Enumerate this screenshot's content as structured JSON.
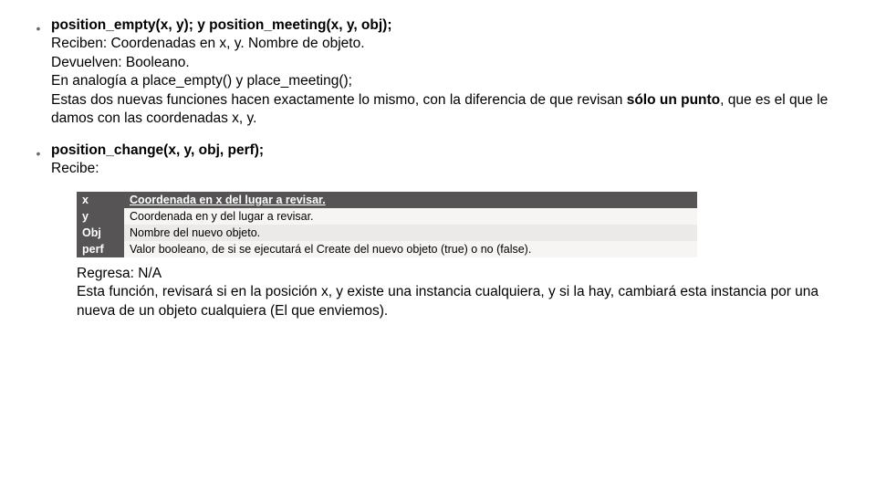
{
  "item1": {
    "fn1_name": "position_empty",
    "fn1_args": "(x, y);",
    "conj": " y ",
    "fn2_name": "position_meeting",
    "fn2_args": "(x, y, obj);",
    "line2": "Reciben: Coordenadas en x, y. Nombre de objeto.",
    "line3": "Devuelven: Booleano.",
    "line4": "En analogía a place_empty() y place_meeting();",
    "line5a": "Estas dos nuevas funciones hacen exactamente lo mismo, con la diferencia de que revisan ",
    "line5b": "sólo un punto",
    "line5c": ", que es el que le damos con las coordenadas x, y."
  },
  "item2": {
    "fn_name": "position_change",
    "fn_args": "(x, y, obj, perf);",
    "line2": "Recibe:"
  },
  "table": {
    "r1": {
      "k": "x",
      "v": "Coordenada en x del lugar a revisar."
    },
    "r2": {
      "k": "y",
      "v": "Coordenada en y del lugar a revisar."
    },
    "r3": {
      "k": "Obj",
      "v": "Nombre del nuevo objeto."
    },
    "r4": {
      "k": "perf",
      "v": "Valor booleano, de si se ejecutará el Create del nuevo objeto (true) o no (false)."
    }
  },
  "after": {
    "line1": "Regresa: N/A",
    "line2": "Esta función, revisará si en la posición x, y existe una instancia cualquiera, y si la hay, cambiará esta instancia por una nueva de un objeto cualquiera (El que enviemos)."
  }
}
